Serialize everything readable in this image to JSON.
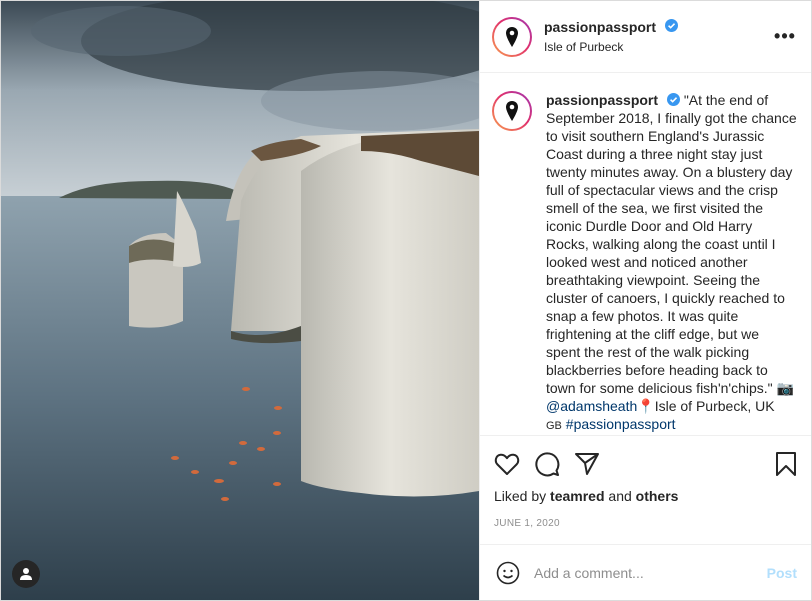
{
  "post": {
    "username": "passionpassport",
    "location": "Isle of Purbeck",
    "more_label": "•••",
    "caption_text": "\"At the end of September 2018, I finally got the chance to visit southern England's Jurassic Coast during a three night stay just twenty minutes away. On a blustery day full of spectacular views and the crisp smell of the sea, we first visited the iconic Durdle Door and Old Harry Rocks, walking along the coast until I looked west and noticed another breathtaking viewpoint. Seeing the cluster of canoers, I quickly reached to snap a few photos. It was quite frightening at the cliff edge, but we spent the rest of the walk picking blackberries before heading back to town for some delicious fish'n'chips.\"",
    "camera_emoji": "📷",
    "mention": "@adamsheath",
    "pin_emoji": "📍",
    "caption_location": "Isle of Purbeck, UK",
    "flag_code": "GB",
    "hashtag": "#passionpassport"
  },
  "actions": {
    "liked_by_prefix": "Liked by",
    "liked_by_user": "teamred",
    "liked_by_and": "and",
    "liked_by_others": "others",
    "date": "JUNE 1, 2020"
  },
  "comment_box": {
    "placeholder": "Add a comment...",
    "post_label": "Post"
  },
  "colors": {
    "link": "#00376b",
    "verified": "#3897f0",
    "post_disabled": "#b2dffc"
  }
}
